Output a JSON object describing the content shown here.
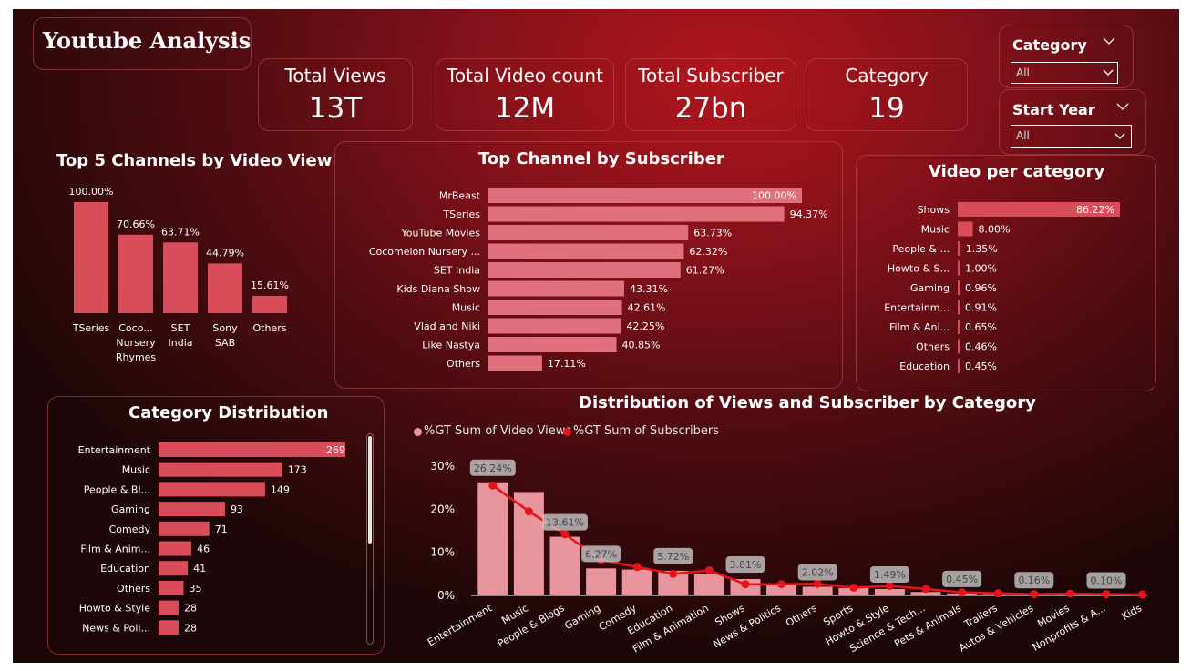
{
  "report_title": "Youtube Analysis",
  "kpis": [
    {
      "label": "Total Views",
      "value": "13T"
    },
    {
      "label": "Total Video count",
      "value": "12M"
    },
    {
      "label": "Total Subscriber",
      "value": "27bn"
    },
    {
      "label": "Category",
      "value": "19"
    }
  ],
  "slicers": [
    {
      "label": "Category",
      "value": "All"
    },
    {
      "label": "Start Year",
      "value": "All"
    }
  ],
  "colors": {
    "bar": "#d94c5a",
    "bar_light": "#e0707c",
    "line": "#e5131c",
    "view_bar": "#e8959d",
    "label_bg": "#c8c8c8"
  },
  "chart_data": [
    {
      "id": "top5",
      "type": "bar",
      "title": "Top 5 Channels by Video View",
      "categories": [
        "TSeries",
        "Coco... Nursery Rhymes",
        "SET India",
        "Sony SAB",
        "Others"
      ],
      "values": [
        100.0,
        70.66,
        63.71,
        44.79,
        15.61
      ],
      "data_labels": [
        "100.00%",
        "70.66%",
        "63.71%",
        "44.79%",
        "15.61%"
      ]
    },
    {
      "id": "subscriber",
      "type": "bar",
      "orientation": "horizontal",
      "title": "Top Channel by Subscriber",
      "categories": [
        "MrBeast",
        "TSeries",
        "YouTube Movies",
        "Cocomelon Nursery ...",
        "SET India",
        "Kids Diana Show",
        "Music",
        "Vlad and Niki",
        "Like Nastya",
        "Others"
      ],
      "values": [
        100.0,
        94.37,
        63.73,
        62.32,
        61.27,
        43.31,
        42.61,
        42.25,
        40.85,
        17.11
      ],
      "data_labels": [
        "100.00%",
        "94.37%",
        "63.73%",
        "62.32%",
        "61.27%",
        "43.31%",
        "42.61%",
        "42.25%",
        "40.85%",
        "17.11%"
      ]
    },
    {
      "id": "videocat",
      "type": "bar",
      "orientation": "horizontal",
      "title": "Video per category",
      "categories": [
        "Shows",
        "Music",
        "People & ...",
        "Howto & S...",
        "Gaming",
        "Entertainm...",
        "Film & Ani...",
        "Others",
        "Education"
      ],
      "values": [
        86.22,
        8.0,
        1.35,
        1.0,
        0.96,
        0.91,
        0.65,
        0.46,
        0.45
      ],
      "data_labels": [
        "86.22%",
        "8.00%",
        "1.35%",
        "1.00%",
        "0.96%",
        "0.91%",
        "0.65%",
        "0.46%",
        "0.45%"
      ]
    },
    {
      "id": "catdist",
      "type": "bar",
      "orientation": "horizontal",
      "title": "Category Distribution",
      "categories": [
        "Entertainment",
        "Music",
        "People & Bl...",
        "Gaming",
        "Comedy",
        "Film & Anim...",
        "Education",
        "Others",
        "Howto & Style",
        "News & Poli..."
      ],
      "values": [
        269,
        173,
        149,
        93,
        71,
        46,
        41,
        35,
        28,
        28
      ],
      "data_labels": [
        "269",
        "173",
        "149",
        "93",
        "71",
        "46",
        "41",
        "35",
        "28",
        "28"
      ]
    },
    {
      "id": "combo",
      "type": "bar",
      "title": "Distribution of Views and Subscriber by Category",
      "categories": [
        "Entertainment",
        "Music",
        "People & Blogs",
        "Gaming",
        "Comedy",
        "Education",
        "Film & Animation",
        "Shows",
        "News & Politics",
        "Others",
        "Sports",
        "Howto & Style",
        "Science & Tech...",
        "Pets & Animals",
        "Trailers",
        "Autos & Vehicles",
        "Movies",
        "Nonprofits & A...",
        "Kids"
      ],
      "series": [
        {
          "name": "%GT Sum of Video Views",
          "type": "bar",
          "values": [
            26.24,
            24.0,
            13.61,
            6.27,
            6.0,
            5.72,
            5.0,
            3.81,
            2.5,
            2.02,
            1.7,
            1.49,
            0.8,
            0.45,
            0.3,
            0.16,
            0.15,
            0.1,
            0.1
          ]
        },
        {
          "name": "%GT Sum of Subscribers",
          "type": "line",
          "values": [
            25.5,
            19.5,
            14.2,
            8.2,
            6.6,
            5.0,
            5.8,
            2.6,
            2.6,
            2.7,
            1.8,
            2.2,
            1.5,
            0.7,
            0.5,
            0.3,
            0.4,
            0.3,
            0.2
          ]
        }
      ],
      "data_labels": [
        "26.24%",
        "13.61%",
        "6.27%",
        "5.72%",
        "3.81%",
        "2.02%",
        "1.49%",
        "0.45%",
        "0.16%",
        "0.10%"
      ],
      "yticks": [
        "30%",
        "20%",
        "10%",
        "0%"
      ],
      "ylim": [
        0,
        30
      ]
    }
  ]
}
